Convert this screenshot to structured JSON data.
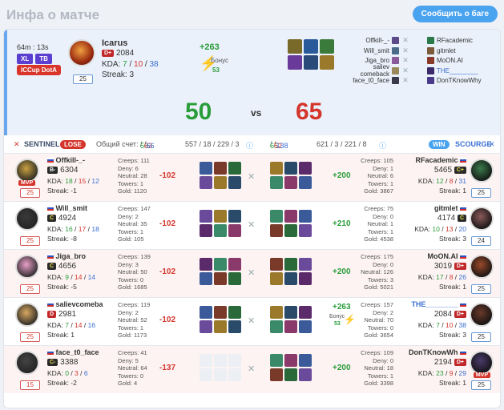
{
  "page": {
    "title": "Инфа о матче",
    "report_button": "Сообщить о баге"
  },
  "match": {
    "duration": "64m : 13s",
    "mode_badges": [
      "XL",
      "TB"
    ],
    "league": "ICCup DotA",
    "winner": {
      "name": "Icarus",
      "rank": "D+",
      "mmr": "2084",
      "kda_label": "KDA:",
      "kills": "7",
      "deaths": "10",
      "assists": "38",
      "streak": "Streak: 3",
      "level": "25"
    },
    "bonus": {
      "delta": "+263",
      "label": "Бонус",
      "value": "53"
    },
    "score_left": "50",
    "vs": "vs",
    "score_right": "65",
    "picks": {
      "left": [
        "Offkill-_-",
        "Will_smit",
        "Jiga_bro",
        "saliev comeback",
        "face_t0_face"
      ],
      "right": [
        "RFacademic",
        "gitmlet",
        "MoON.AI",
        "THE________",
        "DonTKnowWhy"
      ]
    }
  },
  "teams": {
    "sentinel": {
      "name": "SENTINEL",
      "result": "LOSE",
      "total_label": "Общий счет:",
      "k": "50",
      "d": "63",
      "a": "66",
      "extra": "557 / 18 / 229 / 3"
    },
    "scourge": {
      "name": "SCOURGE",
      "result": "WIN",
      "k": "65",
      "d": "52",
      "a": "138",
      "extra": "621 / 3 / 221 / 8"
    }
  },
  "players": [
    {
      "left": {
        "name": "Offkill-_-",
        "rank": "B-",
        "mmr": "6304",
        "k": "18",
        "d": "15",
        "a": "12",
        "streak": "Streak: -1",
        "level": "25",
        "mvp": "MVP",
        "creeps": "Creeps: 111",
        "deny": "Deny: 6",
        "neutral": "Neutral: 28",
        "towers": "Towers: 1",
        "gold": "Gold: 1120",
        "delta": "-102"
      },
      "right": {
        "name": "RFacademic",
        "rank": "C+",
        "mmr": "5465",
        "k": "12",
        "d": "8",
        "a": "31",
        "streak": "Streak: 1",
        "level": "25",
        "creeps": "Creeps: 105",
        "deny": "Deny: 1",
        "neutral": "Neutral: 6",
        "towers": "Towers: 1",
        "gold": "Gold: 3867",
        "delta": "+200"
      }
    },
    {
      "left": {
        "name": "Will_smit",
        "rank": "C",
        "mmr": "4924",
        "k": "16",
        "d": "17",
        "a": "18",
        "streak": "Streak: -8",
        "level": "25",
        "creeps": "Creeps: 147",
        "deny": "Deny: 2",
        "neutral": "Neutral: 35",
        "towers": "Towers: 1",
        "gold": "Gold: 105",
        "delta": "-102"
      },
      "right": {
        "name": "gitmlet",
        "rank": "C",
        "mmr": "4174",
        "k": "10",
        "d": "13",
        "a": "20",
        "streak": "Streak: 3",
        "level": "24",
        "creeps": "Creeps: 75",
        "deny": "Deny: 0",
        "neutral": "Neutral: 1",
        "towers": "Towers: 1",
        "gold": "Gold: 4538",
        "delta": "+210"
      }
    },
    {
      "left": {
        "name": "Jiga_bro",
        "rank": "C",
        "mmr": "4656",
        "k": "9",
        "d": "14",
        "a": "14",
        "streak": "Streak: -5",
        "level": "25",
        "creeps": "Creeps: 139",
        "deny": "Deny: 3",
        "neutral": "Neutral: 50",
        "towers": "Towers: 0",
        "gold": "Gold: 1685",
        "delta": "-102"
      },
      "right": {
        "name": "MoON.AI",
        "rank": "D+",
        "mmr": "3019",
        "k": "17",
        "d": "8",
        "a": "26",
        "streak": "Streak: 1",
        "level": "25",
        "creeps": "Creeps: 175",
        "deny": "Deny: 0",
        "neutral": "Neutral: 126",
        "towers": "Towers: 3",
        "gold": "Gold: 5021",
        "delta": "+200"
      }
    },
    {
      "left": {
        "name": "salievcomeba",
        "rank": "D",
        "mmr": "2981",
        "k": "7",
        "d": "14",
        "a": "16",
        "streak": "Streak: 1",
        "level": "25",
        "creeps": "Creeps: 119",
        "deny": "Deny: 2",
        "neutral": "Neutral: 52",
        "towers": "Towers: 1",
        "gold": "Gold: 1173",
        "delta": "-102"
      },
      "right": {
        "name": "THE________",
        "rank": "D+",
        "mmr": "2084",
        "k": "7",
        "d": "10",
        "a": "38",
        "streak": "Streak: 3",
        "level": "25",
        "creeps": "Creeps: 157",
        "deny": "Deny: 2",
        "neutral": "Neutral: 70",
        "towers": "Towers: 0",
        "gold": "Gold: 3654",
        "delta": "+263",
        "bonus_label": "Бонус",
        "bonus_value": "53"
      }
    },
    {
      "left": {
        "name": "face_t0_face",
        "rank": "C-",
        "mmr": "3388",
        "k": "0",
        "d": "3",
        "a": "6",
        "streak": "Streak: -2",
        "level": "15",
        "creeps": "Creeps: 41",
        "deny": "Deny: 5",
        "neutral": "Neutral: 64",
        "towers": "Towers: 0",
        "gold": "Gold: 4",
        "delta": "-137"
      },
      "right": {
        "name": "DonTKnowWh",
        "rank": "D+",
        "mmr": "2194",
        "k": "23",
        "d": "9",
        "a": "29",
        "streak": "Streak: 1",
        "level": "25",
        "mvp": "MVP",
        "creeps": "Creeps: 109",
        "deny": "Deny: 0",
        "neutral": "Neutral: 18",
        "towers": "Towers: 1",
        "gold": "Gold: 3398",
        "delta": "+200"
      }
    }
  ],
  "colors": {
    "accent": "#4aa3ef",
    "lose": "#d4362c",
    "win": "#2a9d3a",
    "kills": "#3a6fd0"
  },
  "kda_label": "KDA:"
}
